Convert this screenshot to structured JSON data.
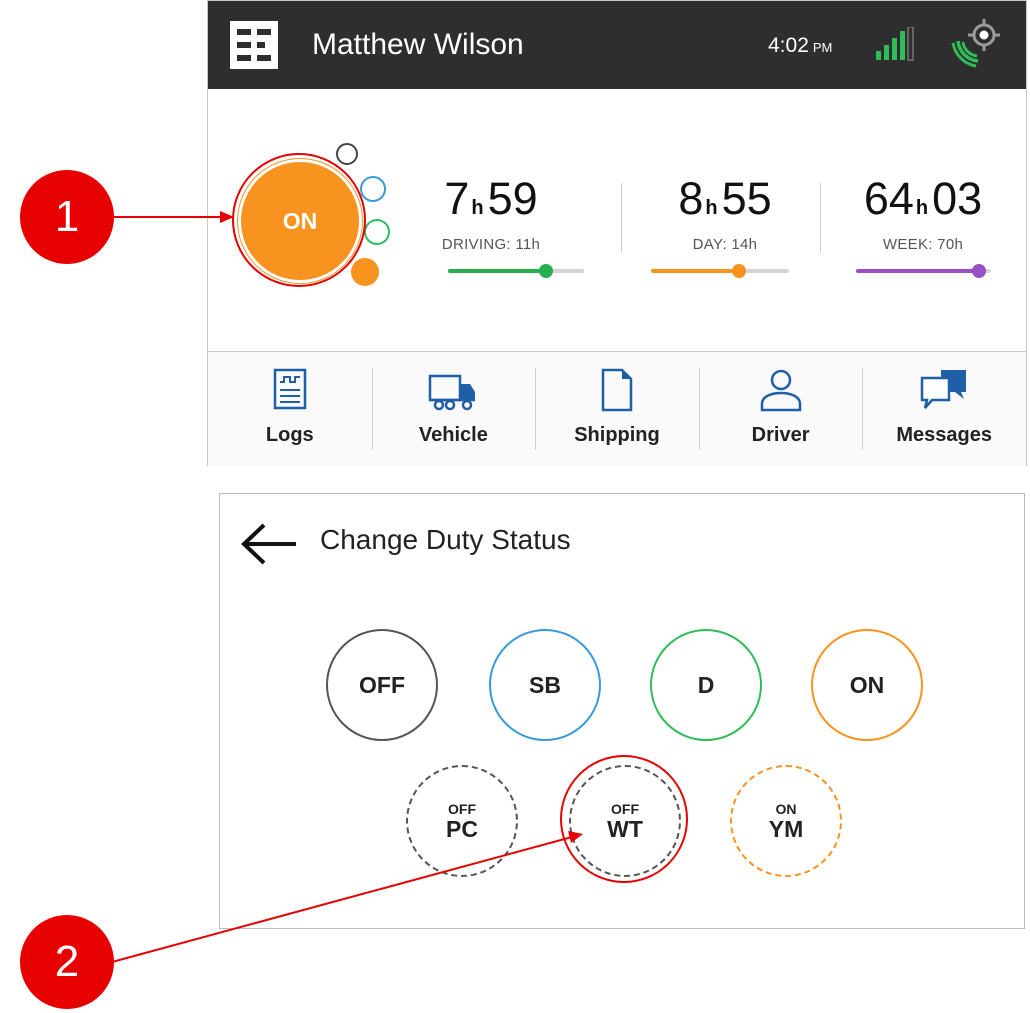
{
  "header": {
    "driver_name": "Matthew Wilson",
    "time": "4:02",
    "time_suffix": "PM"
  },
  "current_status": {
    "label": "ON",
    "color": "#f7931e"
  },
  "clocks": [
    {
      "hours": "7",
      "hour_unit": "h",
      "minutes": "59",
      "label": "DRIVING: 11h",
      "progress": 0.72,
      "color": "#27ae4f"
    },
    {
      "hours": "8",
      "hour_unit": "h",
      "minutes": "55",
      "label": "DAY: 14h",
      "progress": 0.64,
      "color": "#f7931e"
    },
    {
      "hours": "64",
      "hour_unit": "h",
      "minutes": "03",
      "label": "WEEK: 70h",
      "progress": 0.91,
      "color": "#9b4fc4"
    }
  ],
  "nav": [
    {
      "label": "Logs",
      "icon": "logs-icon"
    },
    {
      "label": "Vehicle",
      "icon": "truck-icon"
    },
    {
      "label": "Shipping",
      "icon": "document-icon"
    },
    {
      "label": "Driver",
      "icon": "person-icon"
    },
    {
      "label": "Messages",
      "icon": "chat-icon"
    }
  ],
  "change_duty": {
    "title": "Change Duty Status",
    "primary": [
      {
        "label": "OFF",
        "color": "#555555"
      },
      {
        "label": "SB",
        "color": "#3a9ad9"
      },
      {
        "label": "D",
        "color": "#2ebd59"
      },
      {
        "label": "ON",
        "color": "#f7931e"
      }
    ],
    "special": [
      {
        "small": "OFF",
        "big": "PC",
        "color": "#555555"
      },
      {
        "small": "OFF",
        "big": "WT",
        "color": "#555555"
      },
      {
        "small": "ON",
        "big": "YM",
        "color": "#f7931e"
      }
    ]
  },
  "callouts": [
    "1",
    "2"
  ],
  "colors": {
    "header_bg": "#2e2e2e",
    "callout": "#e60000",
    "signal": "#2ebd59"
  }
}
